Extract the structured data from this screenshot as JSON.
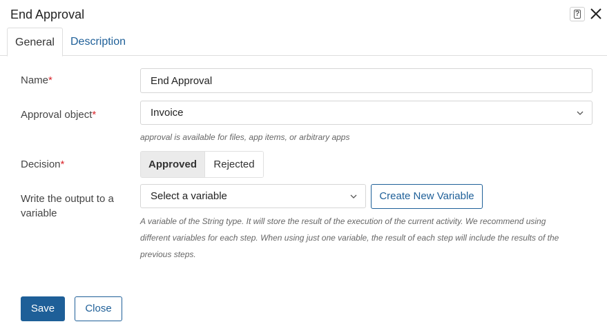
{
  "dialog": {
    "title": "End Approval",
    "help_icon": "question-mark-icon",
    "help_glyph": "?",
    "close_icon": "close-icon"
  },
  "tabs": [
    {
      "label": "General",
      "active": true
    },
    {
      "label": "Description",
      "active": false
    }
  ],
  "form": {
    "name": {
      "label": "Name",
      "required_mark": "*",
      "value": "End Approval"
    },
    "approval_object": {
      "label": "Approval object",
      "required_mark": "*",
      "value": "Invoice",
      "hint": "approval is available for files, app items, or arbitrary apps"
    },
    "decision": {
      "label": "Decision",
      "required_mark": "*",
      "options": [
        "Approved",
        "Rejected"
      ],
      "selected": "Approved"
    },
    "output_variable": {
      "label": "Write the output to a variable",
      "placeholder": "Select a variable",
      "create_button": "Create New Variable",
      "hint_lines": [
        "A variable of the String type. It will store the result of the execution of the current activity. We recommend using",
        "different variables for each step. When using just one variable, the result of each step will include the results of the",
        "previous steps."
      ]
    }
  },
  "footer": {
    "save_label": "Save",
    "close_label": "Close"
  },
  "colors": {
    "accent": "#1e5f98",
    "required": "#d9262c",
    "border": "#d5d5d5"
  }
}
